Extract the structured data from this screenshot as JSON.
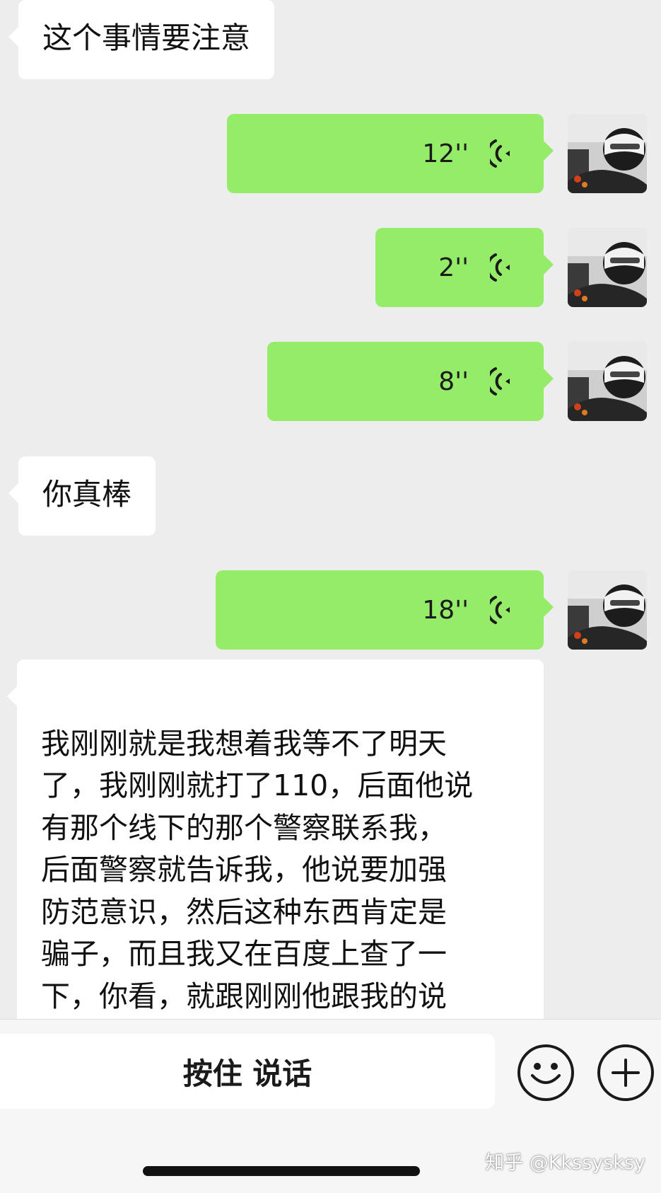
{
  "messages": {
    "m1": {
      "text": "这个事情要注意"
    },
    "m2": {
      "duration": "12''"
    },
    "m3": {
      "duration": "2''"
    },
    "m4": {
      "duration": "8''"
    },
    "m5": {
      "text": "你真棒"
    },
    "m6": {
      "duration": "18''"
    },
    "m7": {
      "text": "我刚刚就是我想着我等不了明天\n了，我刚刚就打了110，后面他说\n有那个线下的那个警察联系我，\n后面警察就告诉我，他说要加强\n防范意识，然后这种东西肯定是\n骗子，而且我又在百度上查了一\n下，你看，就跟刚刚他跟我的说\n辞是一模一样儿的。"
    }
  },
  "input_bar": {
    "hold_to_talk_label": "按住 说话",
    "emoji_icon": "emoji-icon",
    "plus_icon": "plus-icon"
  },
  "watermark": {
    "text": "知乎 @Kkssysksy"
  },
  "colors": {
    "background": "#ededed",
    "sent_bubble": "#95ec69",
    "received_bubble": "#ffffff",
    "voice_icon": "#1a1a1a"
  }
}
